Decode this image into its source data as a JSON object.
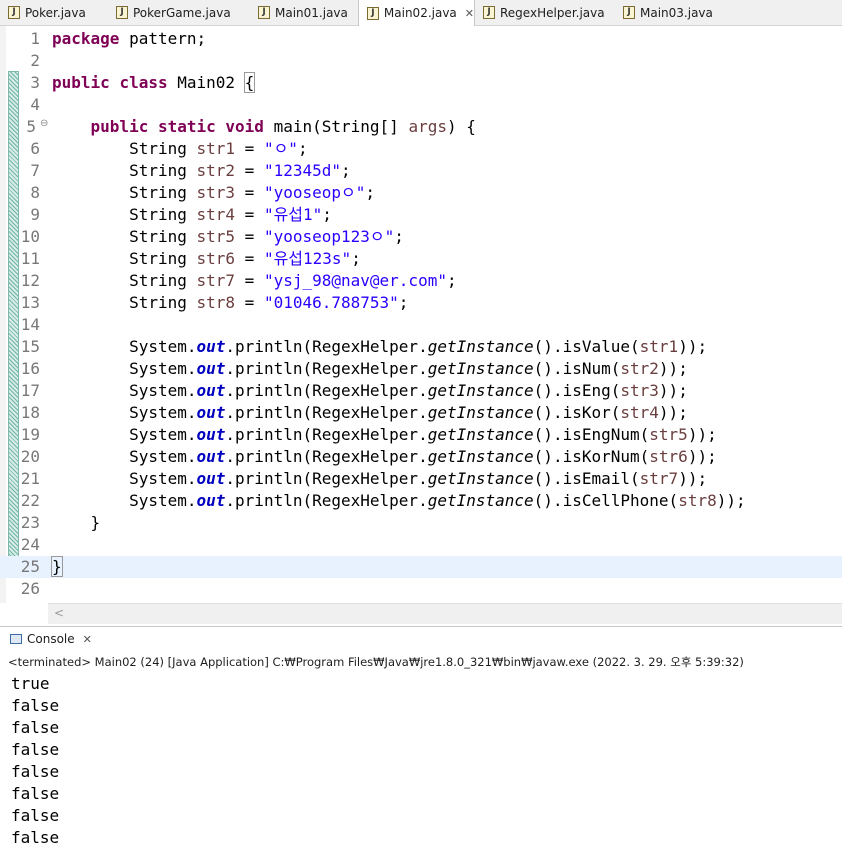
{
  "tabs": [
    {
      "label": "Poker.java",
      "active": false
    },
    {
      "label": "PokerGame.java",
      "active": false
    },
    {
      "label": "Main01.java",
      "active": false
    },
    {
      "label": "Main02.java",
      "active": true,
      "close": "✕"
    },
    {
      "label": "RegexHelper.java",
      "active": false
    },
    {
      "label": "Main03.java",
      "active": false
    }
  ],
  "file_icon_letter": "J",
  "editor": {
    "line_numbers": [
      "1",
      "2",
      "3",
      "4",
      "5",
      "6",
      "7",
      "8",
      "9",
      "10",
      "11",
      "12",
      "13",
      "14",
      "15",
      "16",
      "17",
      "18",
      "19",
      "20",
      "21",
      "22",
      "23",
      "24",
      "25",
      "26"
    ],
    "fold_marker": "⊖",
    "package_kw": "package",
    "package_name": " pattern;",
    "public_kw": "public",
    "class_kw": "class",
    "class_name": " Main02 ",
    "open_brace": "{",
    "static_kw": "static",
    "void_kw": "void",
    "main_sig_a": " main(String[] ",
    "main_args": "args",
    "main_sig_b": ") {",
    "string_type": "String",
    "vars": [
      {
        "name": "str1",
        "value": "\"ㅇ\""
      },
      {
        "name": "str2",
        "value": "\"12345d\""
      },
      {
        "name": "str3",
        "value": "\"yooseopㅇ\""
      },
      {
        "name": "str4",
        "value": "\"유섭1\""
      },
      {
        "name": "str5",
        "value": "\"yooseop123ㅇ\""
      },
      {
        "name": "str6",
        "value": "\"유섭123s\""
      },
      {
        "name": "str7",
        "value": "\"ysj_98@nav@er.com\""
      },
      {
        "name": "str8",
        "value": "\"01046.788753\""
      }
    ],
    "prints": [
      {
        "method": "isValue",
        "arg": "str1"
      },
      {
        "method": "isNum",
        "arg": "str2"
      },
      {
        "method": "isEng",
        "arg": "str3"
      },
      {
        "method": "isKor",
        "arg": "str4"
      },
      {
        "method": "isEngNum",
        "arg": "str5"
      },
      {
        "method": "isKorNum",
        "arg": "str6"
      },
      {
        "method": "isEmail",
        "arg": "str7"
      },
      {
        "method": "isCellPhone",
        "arg": "str8"
      }
    ],
    "system": "System.",
    "out": "out",
    "println": ".println(RegexHelper.",
    "get_instance": "getInstance",
    "call_tail": "().",
    "close_method": "}",
    "close_class": "}"
  },
  "console": {
    "tab_label": "Console",
    "tab_close": "✕",
    "status": "<terminated> Main02 (24) [Java Application] C:₩Program Files₩Java₩jre1.8.0_321₩bin₩javaw.exe (2022. 3. 29. 오후 5:39:32)",
    "output": [
      "true",
      "false",
      "false",
      "false",
      "false",
      "false",
      "false",
      "false"
    ]
  },
  "colors": {
    "keyword": "#7f0055",
    "string": "#2a00ff",
    "variable": "#6a3e3e",
    "field": "#0000c0",
    "current_line": "#e8f2fe"
  }
}
